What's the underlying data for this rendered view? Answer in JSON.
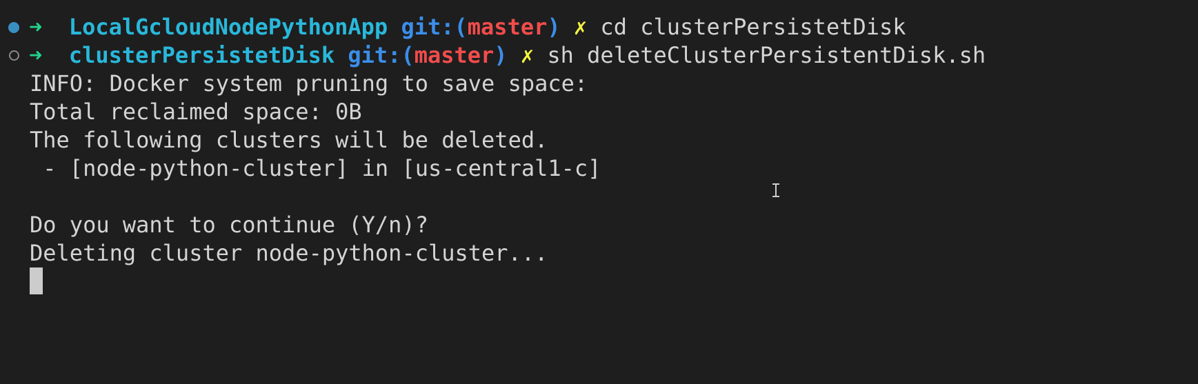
{
  "terminal": {
    "prompts": [
      {
        "arrow": "➜",
        "directory": "LocalGcloudNodePythonApp",
        "git_label": "git:(",
        "branch": "master",
        "git_close": ")",
        "dirty_mark": "✗",
        "command": "cd clusterPersistetDisk",
        "status": "completed"
      },
      {
        "arrow": "➜",
        "directory": "clusterPersistetDisk",
        "git_label": "git:(",
        "branch": "master",
        "git_close": ")",
        "dirty_mark": "✗",
        "command": "sh deleteClusterPersistentDisk.sh",
        "status": "running"
      }
    ],
    "output_lines": [
      "INFO: Docker system pruning to save space:",
      "Total reclaimed space: 0B",
      "The following clusters will be deleted.",
      " - [node-python-cluster] in [us-central1-c]",
      "",
      "Do you want to continue (Y/n)?",
      "Deleting cluster node-python-cluster..."
    ],
    "colors": {
      "background": "#1e1e1e",
      "foreground": "#d4d4d4",
      "arrow": "#23d18b",
      "directory": "#29b8db",
      "git": "#3b8eea",
      "branch": "#f14c4c",
      "dirty": "#f5f543",
      "decoration_success": "#3a8fc1"
    }
  }
}
